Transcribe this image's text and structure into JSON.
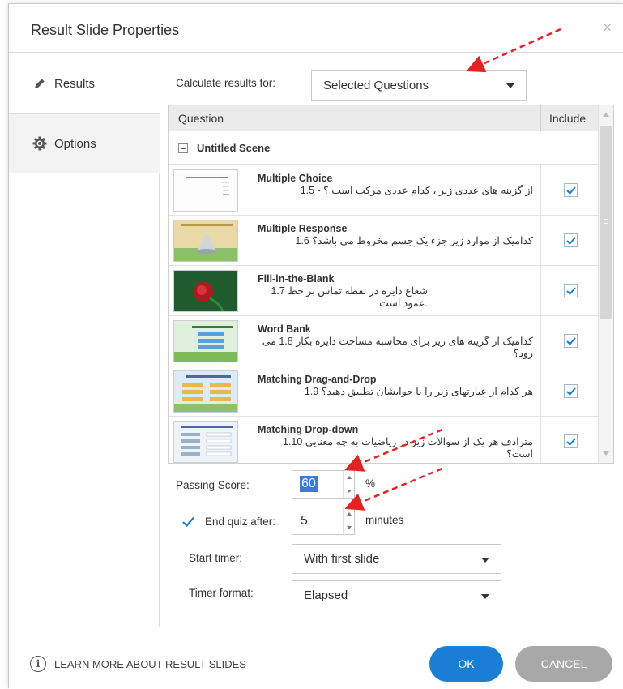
{
  "dialog": {
    "title": "Result Slide Properties",
    "close_glyph": "×"
  },
  "sidebar": {
    "items": [
      {
        "label": "Results",
        "icon": "pencil-icon"
      },
      {
        "label": "Options",
        "icon": "gear-icon"
      }
    ]
  },
  "calculate": {
    "label": "Calculate results for:",
    "selected": "Selected Questions"
  },
  "grid": {
    "headers": {
      "question": "Question",
      "include": "Include"
    },
    "scene_name": "Untitled Scene",
    "rows": [
      {
        "title": "Multiple Choice",
        "text": "از گزینه های عددی زیر ، کدام عددی مرکب است ؟ - 1.5",
        "included": true
      },
      {
        "title": "Multiple Response",
        "text": "کدامیک از موارد زیر جزء یک جسم مخروط می باشد؟ 1.6",
        "included": true
      },
      {
        "title": "Fill-in-the-Blank",
        "text": "شعاع دایره در نقطه تماس بر خط 1.7 .عمود است",
        "included": true
      },
      {
        "title": "Word Bank",
        "text": "کدامیک از گزینه های زیر برای محاسبه مساحت دایره بکار 1.8 می رود؟",
        "included": true
      },
      {
        "title": "Matching Drag-and-Drop",
        "text": "هر کدام از عبارتهای زیر را با جوابشان تطبیق دهید؟ 1.9",
        "included": true
      },
      {
        "title": "Matching Drop-down",
        "text": "مترادف هر یک از سوالات زیر در ریاضیات به چه معنایی 1.10 است؟",
        "included": true
      }
    ]
  },
  "passing": {
    "label": "Passing Score:",
    "value": "60",
    "unit": "%"
  },
  "end_quiz": {
    "label": "End quiz after:",
    "checked": true,
    "value": "5",
    "unit": "minutes"
  },
  "start_timer": {
    "label": "Start timer:",
    "selected": "With first slide"
  },
  "timer_format": {
    "label": "Timer format:",
    "selected": "Elapsed"
  },
  "footer": {
    "learn_more": "LEARN MORE ABOUT RESULT SLIDES",
    "info_glyph": "i",
    "ok": "OK",
    "cancel": "CANCEL"
  },
  "colors": {
    "accent": "#1a7fd4",
    "checkbox_tick": "#1a7fd4",
    "annotation_arrow": "#e32222",
    "selection": "#3b7ad6",
    "cancel_button": "#a8a8a8"
  }
}
